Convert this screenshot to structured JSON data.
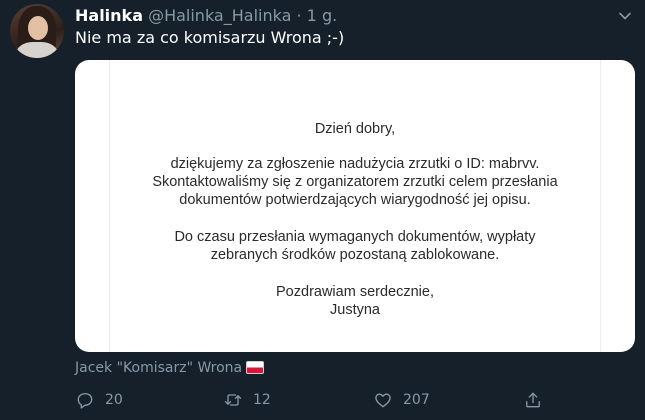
{
  "tweet": {
    "author_name": "Halinka",
    "handle": "@Halinka_Halinka",
    "separator": "·",
    "time": "1 g.",
    "text": "Nie ma za co komisarzu Wrona ;-)"
  },
  "media": {
    "lines": [
      "Dzień dobry,",
      "dziękujemy za zgłoszenie nadużycia zrzutki o ID: mabrvv.",
      "Skontaktowaliśmy się z organizatorem zrzutki celem przesłania",
      "dokumentów potwierdzających wiarygodność jej opisu.",
      "Do czasu przesłania wymaganych dokumentów, wypłaty",
      "zebranych środków pozostaną zablokowane.",
      "Pozdrawiam serdecznie,",
      "Justyna"
    ],
    "tag": "Jacek \"Komisarz\" Wrona",
    "tag_flag_icon": "poland-flag-icon"
  },
  "actions": {
    "reply_count": "20",
    "retweet_count": "12",
    "like_count": "207"
  },
  "icons": {
    "reply": "reply-icon",
    "retweet": "retweet-icon",
    "like": "like-icon",
    "share": "share-icon",
    "menu": "chevron-down-icon"
  },
  "colors": {
    "background": "#15202b",
    "secondary_text": "#8899a6",
    "primary_text": "#ffffff"
  }
}
